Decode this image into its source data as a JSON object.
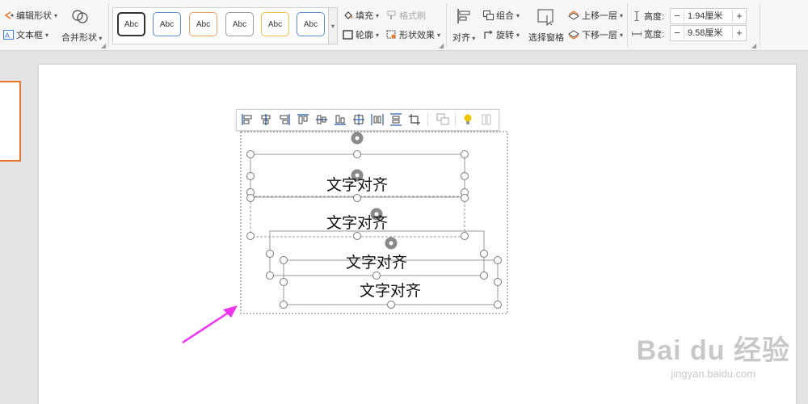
{
  "ribbon": {
    "edit_shape": "编辑形状",
    "text_box": "文本框",
    "merge_shapes": "合并形状",
    "style_samples": [
      "Abc",
      "Abc",
      "Abc",
      "Abc",
      "Abc",
      "Abc"
    ],
    "fill": "填充",
    "format_painter": "格式刷",
    "outline": "轮廓",
    "shape_effects": "形状效果",
    "align": "对齐",
    "group": "组合",
    "rotate": "旋转",
    "selection_pane": "选择窗格",
    "bring_forward": "上移一层",
    "send_backward": "下移一层",
    "height_label": "高度:",
    "height_value": "1.94厘米",
    "width_label": "宽度:",
    "width_value": "9.58厘米",
    "minus": "−",
    "plus": "+"
  },
  "slide": {
    "text_boxes": [
      "文字对齐",
      "文字对齐",
      "文字对齐",
      "文字对齐"
    ]
  },
  "watermark": {
    "brand": "Bai du 经验",
    "url": "jingyan.baidu.com"
  },
  "colors": {
    "accent_orange": "#e8772e",
    "arrow_magenta": "#ee33ee",
    "bulb_yellow": "#f5c400"
  }
}
